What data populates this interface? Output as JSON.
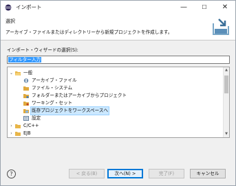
{
  "window": {
    "title": "インポート",
    "minimize": "—",
    "maximize": "☐",
    "close": "✕"
  },
  "header": {
    "title": "選択",
    "description": "アーカイブ・ファイルまたはディレクトリーから新規プロジェクトを作成します。",
    "graphic_icon": "import-wizard-banner-icon"
  },
  "wizard": {
    "label": "インポート・ウィザードの選択(S):",
    "filter_value": "フィルター入力"
  },
  "tree": {
    "items": [
      {
        "label": "一般",
        "expanded": true,
        "level": 0,
        "icon": "folder-open-icon"
      },
      {
        "label": "アーカイブ・ファイル",
        "level": 1,
        "icon": "archive-file-icon"
      },
      {
        "label": "ファイル・システム",
        "level": 1,
        "icon": "file-system-icon"
      },
      {
        "label": "フォルダーまたはアーカイブからプロジェクト",
        "level": 1,
        "icon": "folder-project-icon"
      },
      {
        "label": "ワーキング・セット",
        "level": 1,
        "icon": "working-set-icon"
      },
      {
        "label": "既存プロジェクトをワークスペースへ",
        "level": 1,
        "icon": "existing-project-icon",
        "selected": true
      },
      {
        "label": "設定",
        "level": 1,
        "icon": "preferences-icon"
      },
      {
        "label": "C/C++",
        "expanded": false,
        "level": 0,
        "icon": "folder-icon"
      },
      {
        "label": "EJB",
        "expanded": false,
        "level": 0,
        "icon": "folder-icon"
      }
    ]
  },
  "footer": {
    "help": "?",
    "back_label": "< 戻る(B)",
    "next_label": "次へ(N) >",
    "finish_label": "完了(F)",
    "cancel_label": "キャンセル"
  },
  "colors": {
    "selection_fill": "#cce8ff",
    "filter_highlight": "#3399ff",
    "default_button_border": "#0078d7"
  }
}
